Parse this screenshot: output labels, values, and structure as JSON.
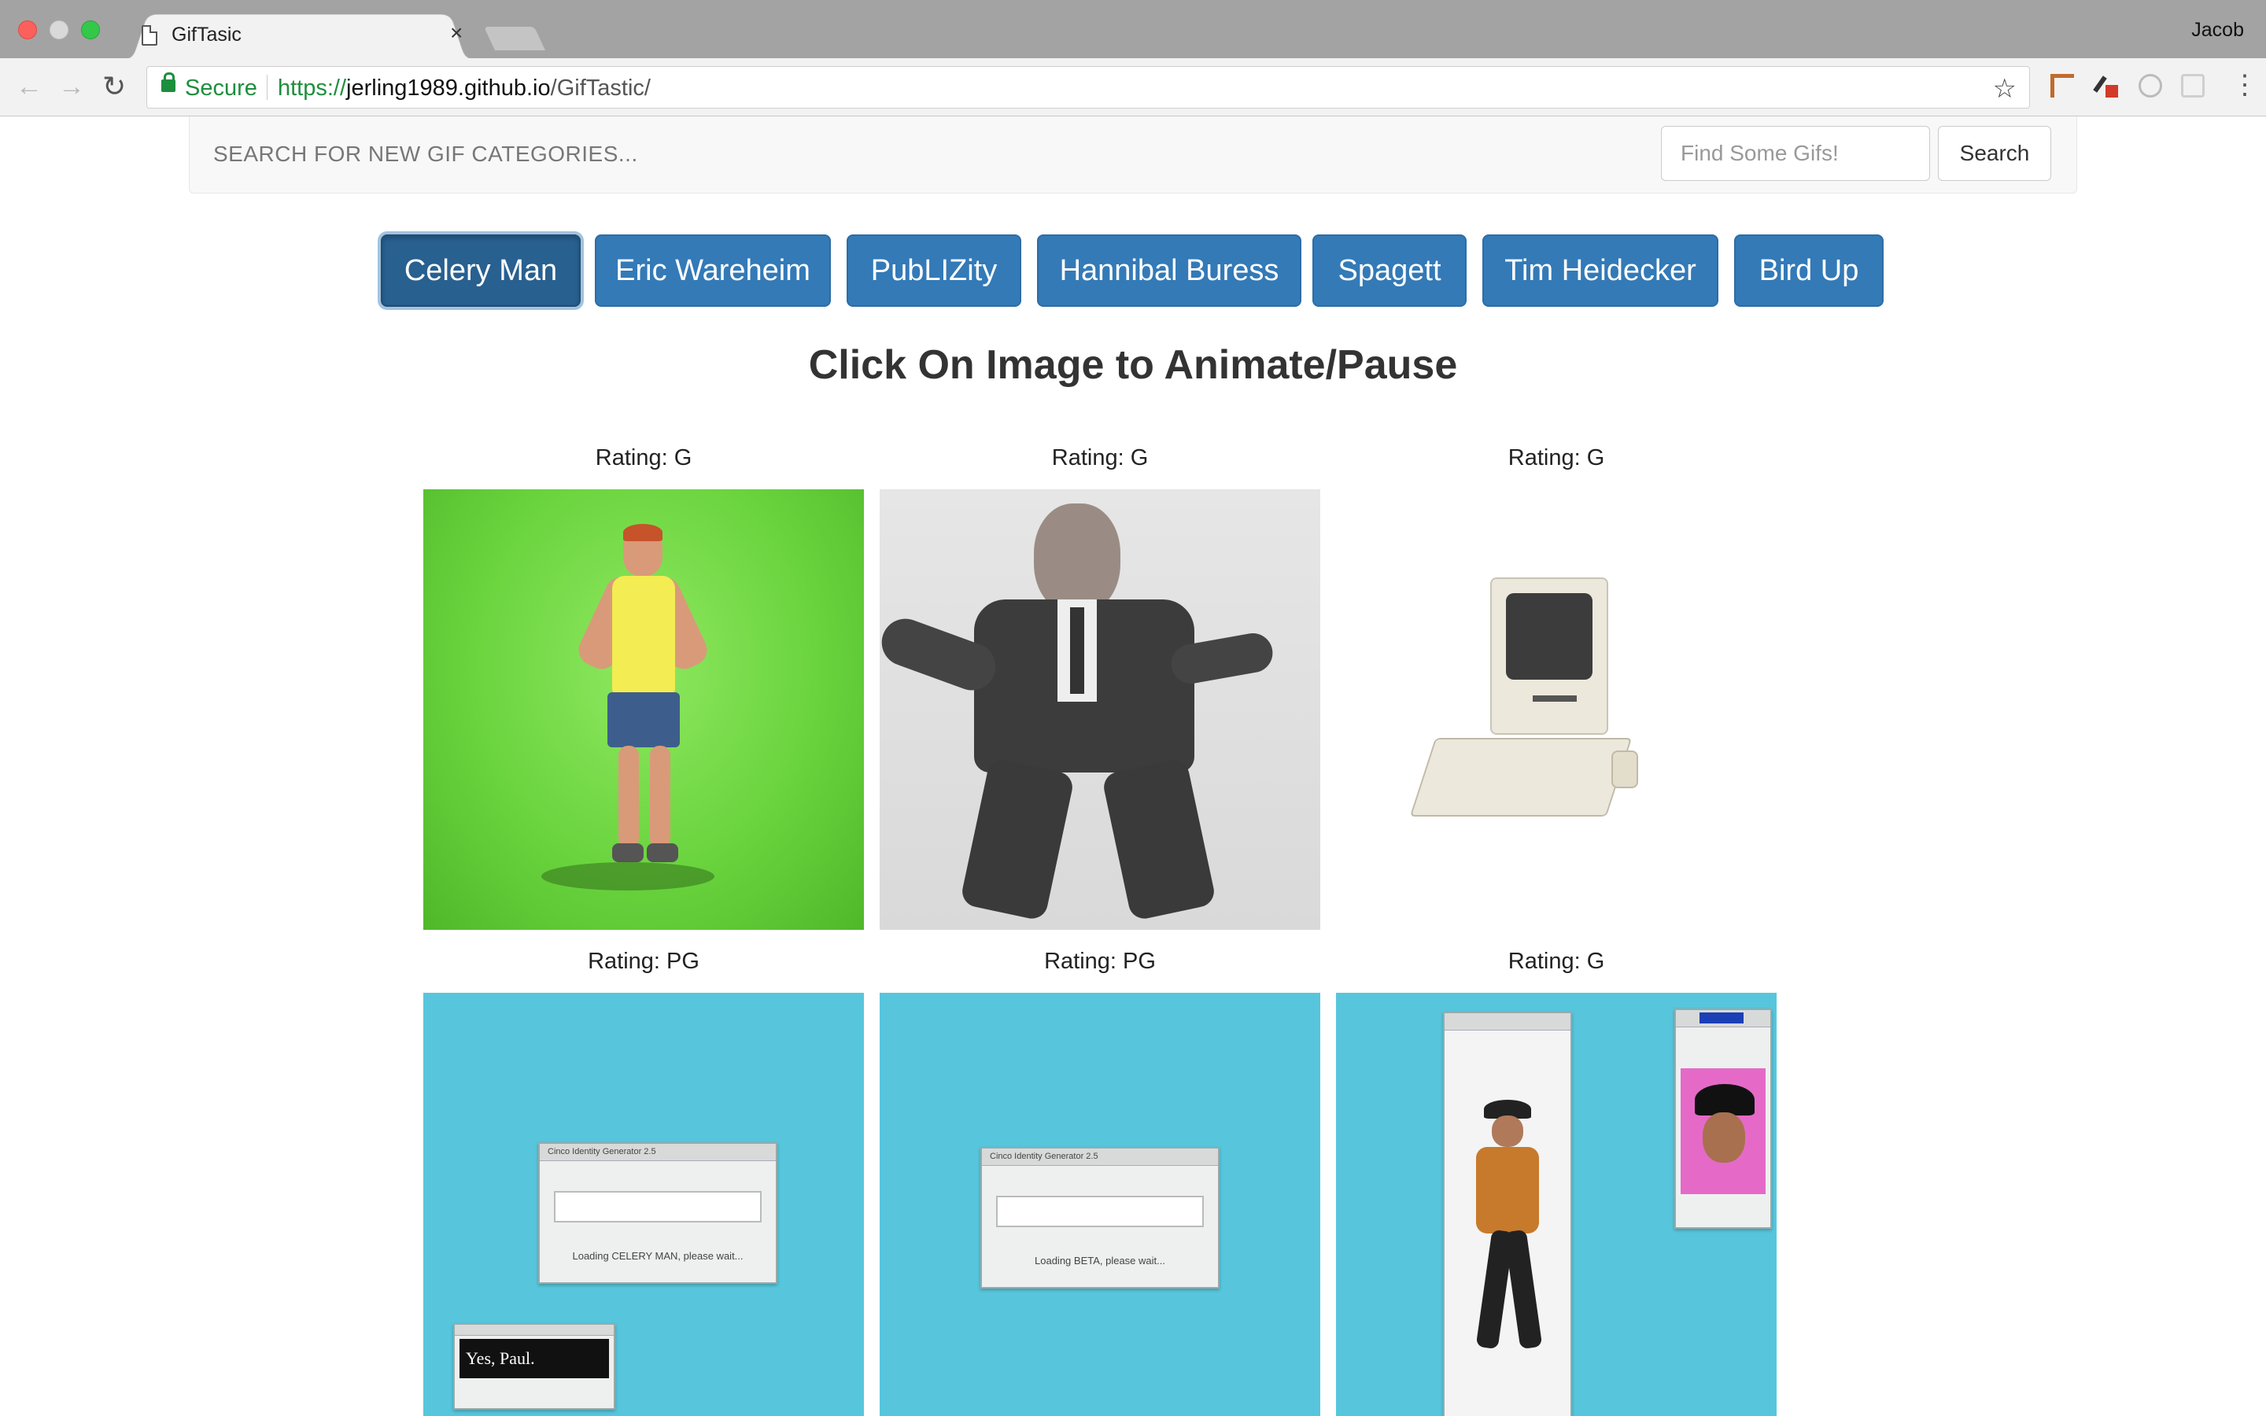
{
  "browser": {
    "tab_title": "GifTasic",
    "tab_close": "×",
    "profile_name": "Jacob",
    "secure_label": "Secure",
    "url_scheme": "https://",
    "url_host": "jerling1989.github.io",
    "url_path": "/GifTastic/",
    "back_glyph": "←",
    "forward_glyph": "→",
    "reload_glyph": "↻",
    "star_glyph": "☆",
    "menu_glyph": "⋮"
  },
  "navbar": {
    "label": "SEARCH FOR NEW GIF CATEGORIES...",
    "search_placeholder": "Find Some Gifs!",
    "search_button": "Search"
  },
  "categories": [
    {
      "label": "Celery Man",
      "active": true
    },
    {
      "label": "Eric Wareheim",
      "active": false
    },
    {
      "label": "PubLIZity",
      "active": false
    },
    {
      "label": "Hannibal Buress",
      "active": false
    },
    {
      "label": "Spagett",
      "active": false
    },
    {
      "label": "Tim Heidecker",
      "active": false
    },
    {
      "label": "Bird Up",
      "active": false
    }
  ],
  "instructions": "Click On Image to Animate/Pause",
  "gifs": [
    {
      "rating": "Rating: G",
      "depicts": "man dancing on green screen"
    },
    {
      "rating": "Rating: G",
      "depicts": "man in suit dancing"
    },
    {
      "rating": "Rating: G",
      "depicts": "vintage desktop computer"
    },
    {
      "rating": "Rating: PG",
      "depicts": "loading window on blue desktop",
      "window_title": "Cinco Identity Generator 2.5",
      "window_msg": "Loading CELERY MAN, please wait...",
      "chat_text": "Yes, Paul."
    },
    {
      "rating": "Rating: PG",
      "depicts": "loading window on blue desktop",
      "window_title": "Cinco Identity Generator 2.5",
      "window_msg": "Loading BETA, please wait..."
    },
    {
      "rating": "Rating: G",
      "depicts": "dancing figure in windows on blue desktop"
    }
  ],
  "colors": {
    "button_primary": "#337ab7",
    "button_active": "#286090",
    "secure_green": "#1e8e3e"
  }
}
